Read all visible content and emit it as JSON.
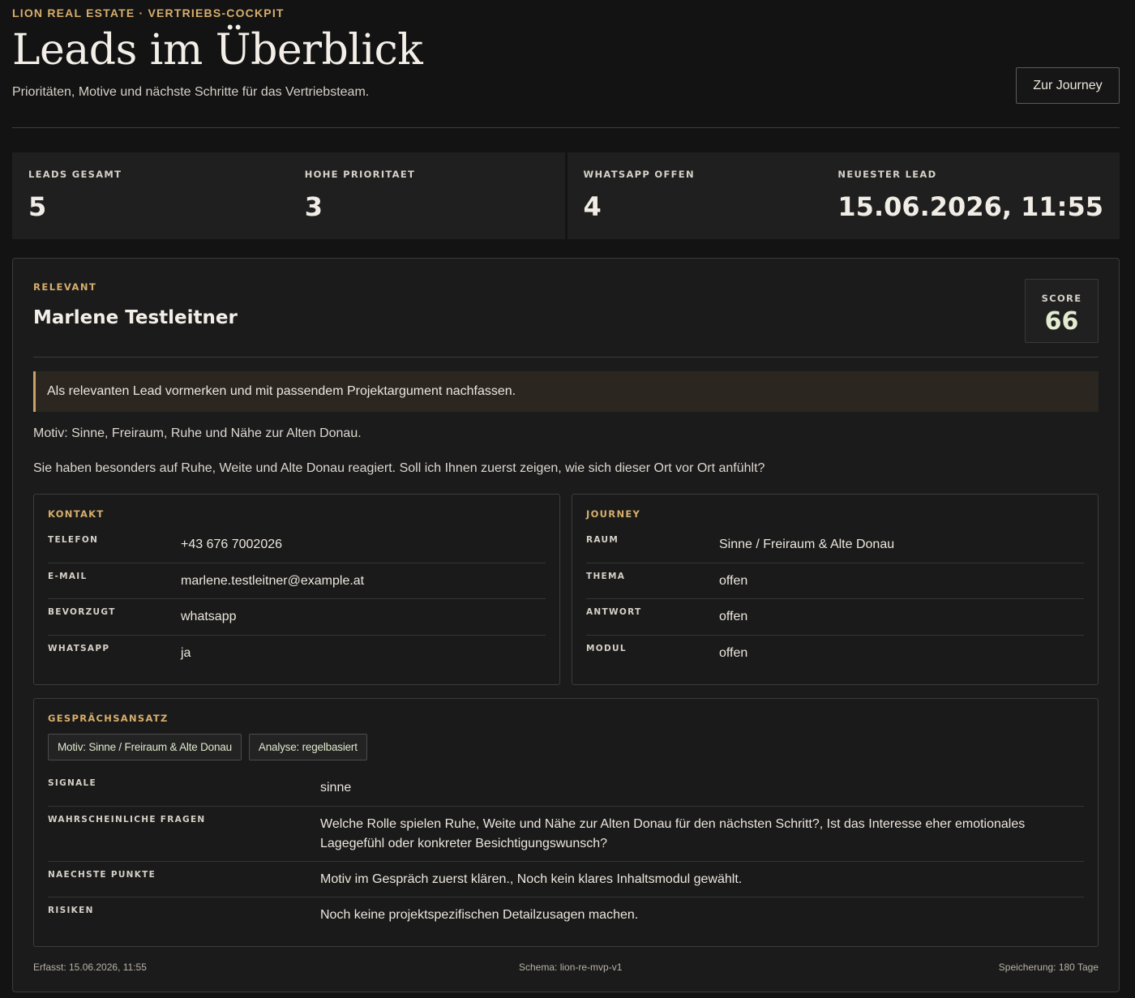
{
  "header": {
    "eyebrow": "LION REAL ESTATE · VERTRIEBS-COCKPIT",
    "title": "Leads im Überblick",
    "subtitle": "Prioritäten, Motive und nächste Schritte für das Vertriebsteam.",
    "journey_button": "Zur Journey"
  },
  "stats": [
    {
      "label": "LEADS GESAMT",
      "value": "5"
    },
    {
      "label": "HOHE PRIORITAET",
      "value": "3"
    },
    {
      "label": "WHATSAPP OFFEN",
      "value": "4"
    },
    {
      "label": "NEUESTER LEAD",
      "value": "15.06.2026, 11:55"
    }
  ],
  "lead": {
    "tag": "RELEVANT",
    "name": "Marlene Testleitner",
    "score_label": "SCORE",
    "score": "66",
    "callout": "Als relevanten Lead vormerken und mit passendem Projektargument nachfassen.",
    "motive": "Motiv: Sinne, Freiraum, Ruhe und Nähe zur Alten Donau.",
    "hook": "Sie haben besonders auf Ruhe, Weite und Alte Donau reagiert. Soll ich Ihnen zuerst zeigen, wie sich dieser Ort vor Ort anfühlt?",
    "contact": {
      "title": "KONTAKT",
      "rows": [
        {
          "key": "TELEFON",
          "value": "+43 676 7002026"
        },
        {
          "key": "E-MAIL",
          "value": "marlene.testleitner@example.at"
        },
        {
          "key": "BEVORZUGT",
          "value": "whatsapp"
        },
        {
          "key": "WHATSAPP",
          "value": "ja"
        }
      ]
    },
    "journey": {
      "title": "JOURNEY",
      "rows": [
        {
          "key": "RAUM",
          "value": "Sinne / Freiraum & Alte Donau"
        },
        {
          "key": "THEMA",
          "value": "offen"
        },
        {
          "key": "ANTWORT",
          "value": "offen"
        },
        {
          "key": "MODUL",
          "value": "offen"
        }
      ]
    },
    "approach": {
      "title": "GESPRÄCHSANSATZ",
      "chips": [
        "Motiv: Sinne / Freiraum & Alte Donau",
        "Analyse: regelbasiert"
      ],
      "rows": [
        {
          "key": "SIGNALE",
          "value": "sinne"
        },
        {
          "key": "WAHRSCHEINLICHE FRAGEN",
          "value": "Welche Rolle spielen Ruhe, Weite und Nähe zur Alten Donau für den nächsten Schritt?, Ist das Interesse eher emotionales Lagegefühl oder konkreter Besichtigungswunsch?"
        },
        {
          "key": "NAECHSTE PUNKTE",
          "value": "Motiv im Gespräch zuerst klären., Noch kein klares Inhaltsmodul gewählt."
        },
        {
          "key": "RISIKEN",
          "value": "Noch keine projektspezifischen Detailzusagen machen."
        }
      ]
    },
    "footer": {
      "captured": "Erfasst: 15.06.2026, 11:55",
      "schema": "Schema: lion-re-mvp-v1",
      "storage": "Speicherung: 180 Tage"
    }
  }
}
